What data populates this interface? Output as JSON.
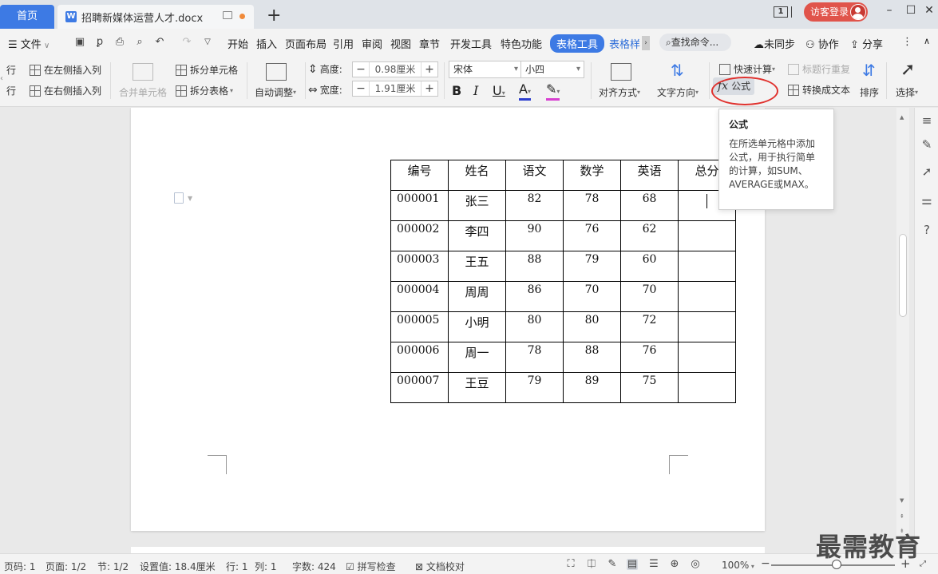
{
  "titlebar": {
    "home_tab": "首页",
    "doc_tab": "招聘新媒体运营人才.docx",
    "doc_icon": "W",
    "page_count": "1",
    "login": "访客登录"
  },
  "menubar": {
    "file": "文件",
    "items": [
      "开始",
      "插入",
      "页面布局",
      "引用",
      "审阅",
      "视图",
      "章节",
      "开发工具",
      "特色功能"
    ],
    "table_tools": "表格工具",
    "table_style": "表格样",
    "search": "查找命令...",
    "sync": "未同步",
    "collab": "协作",
    "share": "分享"
  },
  "ribbon": {
    "insert_row_above": "行",
    "insert_row_below": "行",
    "insert_col_left": "在左侧插入列",
    "insert_col_right": "在右侧插入列",
    "merge_cells": "合并单元格",
    "split_cells": "拆分单元格",
    "split_table": "拆分表格",
    "auto_fit": "自动调整",
    "height_label": "高度:",
    "height_value": "0.98厘米",
    "width_label": "宽度:",
    "width_value": "1.91厘米",
    "font_name": "宋体",
    "font_size": "小四",
    "align": "对齐方式",
    "text_direction": "文字方向",
    "quick_calc": "快速计算",
    "repeat_header": "标题行重复",
    "formula": "公式",
    "to_text": "转换成文本",
    "sort": "排序",
    "select": "选择"
  },
  "tooltip": {
    "title": "公式",
    "body": "在所选单元格中添加公式，用于执行简单的计算，如SUM、AVERAGE或MAX。"
  },
  "table": {
    "headers": [
      "编号",
      "姓名",
      "语文",
      "数学",
      "英语",
      "总分"
    ],
    "rows": [
      [
        "000001",
        "张三",
        "82",
        "78",
        "68",
        ""
      ],
      [
        "000002",
        "李四",
        "90",
        "76",
        "62",
        ""
      ],
      [
        "000003",
        "王五",
        "88",
        "79",
        "60",
        ""
      ],
      [
        "000004",
        "周周",
        "86",
        "70",
        "70",
        ""
      ],
      [
        "000005",
        "小明",
        "80",
        "80",
        "72",
        ""
      ],
      [
        "000006",
        "周一",
        "78",
        "88",
        "76",
        ""
      ],
      [
        "000007",
        "王豆",
        "79",
        "89",
        "75",
        ""
      ]
    ]
  },
  "statusbar": {
    "page_no": "页码: 1",
    "pages": "页面: 1/2",
    "section": "节: 1/2",
    "setting": "设置值: 18.4厘米",
    "row": "行: 1",
    "col": "列: 1",
    "words": "字数: 424",
    "spell_check": "拼写检查",
    "proofread": "文档校对",
    "zoom": "100%"
  },
  "watermark": "最需教育",
  "colors": {
    "accent": "#3d7ae4",
    "login": "#e0544b",
    "highlight_ring": "#e0312d"
  }
}
